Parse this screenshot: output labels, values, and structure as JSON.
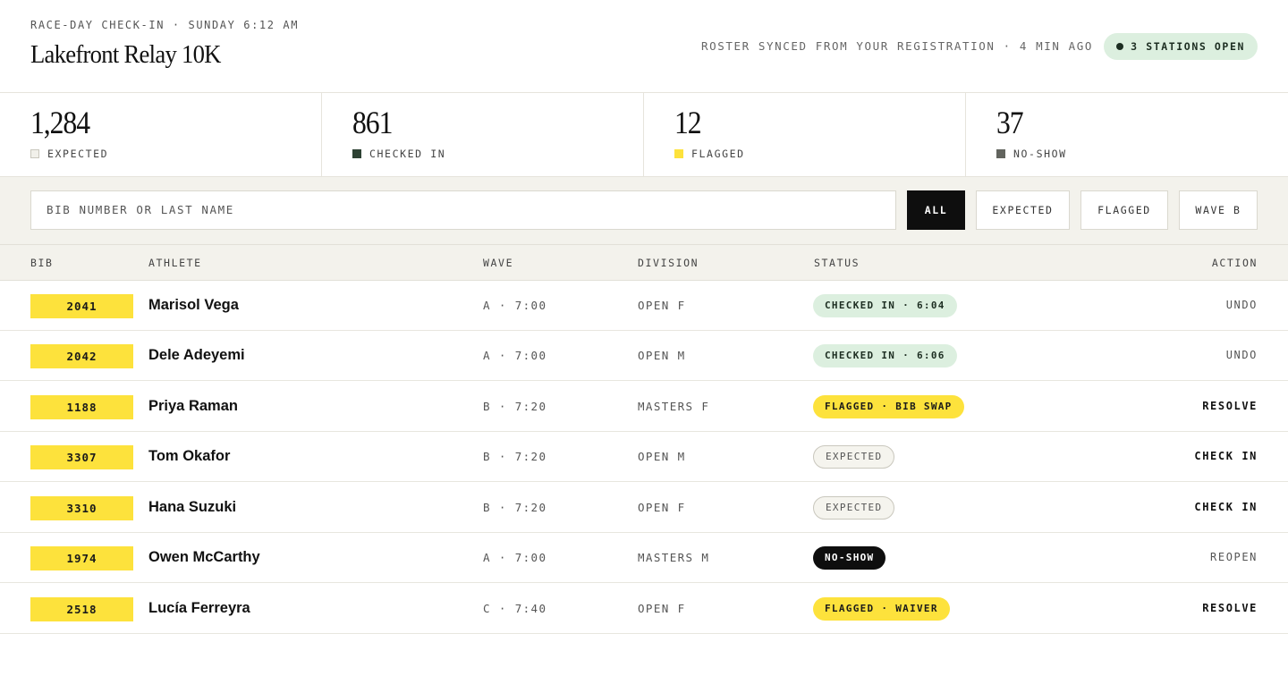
{
  "header": {
    "eyebrow": "RACE-DAY CHECK-IN · SUNDAY 6:12 AM",
    "title": "Lakefront Relay 10K",
    "sync_text": "ROSTER SYNCED FROM YOUR REGISTRATION · 4 MIN AGO",
    "stations_badge": "3 STATIONS OPEN"
  },
  "stats": [
    {
      "value": "1,284",
      "label": "EXPECTED",
      "color": "#eceae3"
    },
    {
      "value": "861",
      "label": "CHECKED IN",
      "color": "#2e4234"
    },
    {
      "value": "12",
      "label": "FLAGGED",
      "color": "#fde23c"
    },
    {
      "value": "37",
      "label": "NO-SHOW",
      "color": "#62645e"
    }
  ],
  "search": {
    "placeholder": "BIB NUMBER OR LAST NAME"
  },
  "filters": [
    "ALL",
    "EXPECTED",
    "FLAGGED",
    "WAVE B"
  ],
  "columns": {
    "bib": "BIB",
    "athlete": "ATHLETE",
    "wave": "WAVE",
    "division": "DIVISION",
    "status": "STATUS",
    "action": "ACTION"
  },
  "rows": [
    {
      "bib": "2041",
      "athlete": "Marisol Vega",
      "wave": "A · 7:00",
      "division": "OPEN F",
      "status": "CHECKED IN · 6:04",
      "action": "UNDO"
    },
    {
      "bib": "2042",
      "athlete": "Dele Adeyemi",
      "wave": "A · 7:00",
      "division": "OPEN M",
      "status": "CHECKED IN · 6:06",
      "action": "UNDO"
    },
    {
      "bib": "1188",
      "athlete": "Priya Raman",
      "wave": "B · 7:20",
      "division": "MASTERS F",
      "status": "FLAGGED · BIB SWAP",
      "action": "RESOLVE"
    },
    {
      "bib": "3307",
      "athlete": "Tom Okafor",
      "wave": "B · 7:20",
      "division": "OPEN M",
      "status": "EXPECTED",
      "action": "CHECK IN"
    },
    {
      "bib": "3310",
      "athlete": "Hana Suzuki",
      "wave": "B · 7:20",
      "division": "OPEN F",
      "status": "EXPECTED",
      "action": "CHECK IN"
    },
    {
      "bib": "1974",
      "athlete": "Owen McCarthy",
      "wave": "A · 7:00",
      "division": "MASTERS M",
      "status": "NO-SHOW",
      "action": "REOPEN"
    },
    {
      "bib": "2518",
      "athlete": "Lucía Ferreyra",
      "wave": "C · 7:40",
      "division": "OPEN F",
      "status": "FLAGGED · WAIVER",
      "action": "RESOLVE"
    }
  ]
}
